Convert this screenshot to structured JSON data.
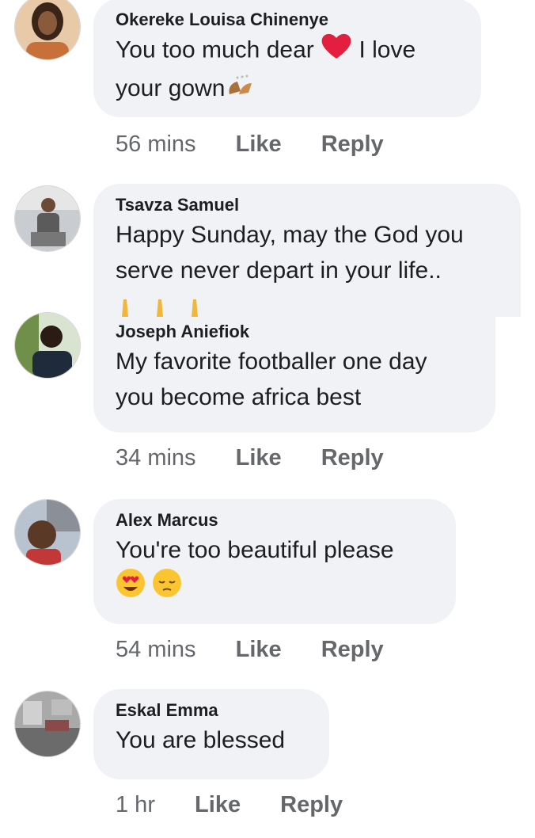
{
  "comments": [
    {
      "author": "Okereke Louisa Chinenye",
      "text_1": "You too much dear",
      "text_1b": "I love",
      "text_2": "your gown",
      "time": "56 mins",
      "like": "Like",
      "reply": "Reply"
    },
    {
      "author": "Tsavza Samuel",
      "text_1": "Happy Sunday, may the God you",
      "text_2": "serve never depart in your life.."
    },
    {
      "author": "Joseph Aniefiok",
      "text_1": "My favorite footballer one day",
      "text_2": "you become africa best",
      "time": "34 mins",
      "like": "Like",
      "reply": "Reply"
    },
    {
      "author": "Alex Marcus",
      "text_1": "You're too beautiful please",
      "time": "54 mins",
      "like": "Like",
      "reply": "Reply"
    },
    {
      "author": "Eskal Emma",
      "text_1": "You are blessed",
      "time": "1 hr",
      "like": "Like",
      "reply": "Reply"
    }
  ],
  "icons": [
    "heart-icon",
    "clapping-hands-icon",
    "praying-hands-icon",
    "heart-eyes-icon",
    "pensive-face-icon"
  ],
  "colors": {
    "bubble": "#f0f2f5",
    "meta_text": "#65676b",
    "heart": "#e41e3f"
  }
}
